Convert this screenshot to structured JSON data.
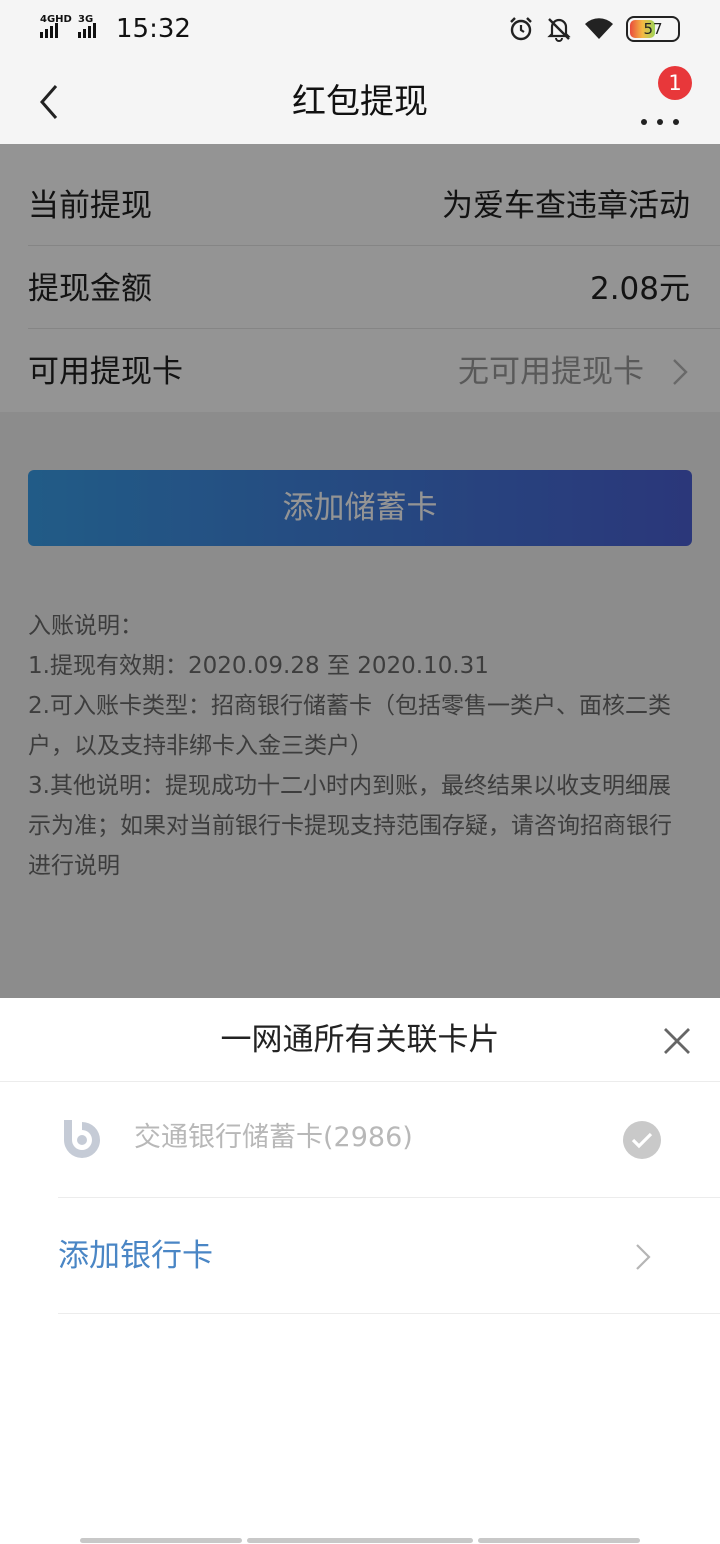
{
  "status_bar": {
    "network_1": "4GHD",
    "network_2": "3G",
    "time": "15:32",
    "battery": "57",
    "icons": [
      "alarm-icon",
      "bell-muted-icon",
      "wifi-icon",
      "battery-icon"
    ]
  },
  "nav": {
    "title": "红包提现",
    "badge_count": "1",
    "back_icon": "chevron-left-icon",
    "more_icon": "more-dots-icon"
  },
  "rows": [
    {
      "label": "当前提现",
      "value": "为爱车查违章活动"
    },
    {
      "label": "提现金额",
      "value": "2.08元"
    },
    {
      "label": "可用提现卡",
      "value": "无可用提现卡"
    }
  ],
  "add_savings_button": "添加储蓄卡",
  "notes": {
    "heading": "入账说明：",
    "line1": "1.提现有效期：2020.09.28 至 2020.10.31",
    "line2": "2.可入账卡类型：招商银行储蓄卡（包括零售一类户、面核二类户，以及支持非绑卡入金三类户）",
    "line3": "3.其他说明：提现成功十二小时内到账，最终结果以收支明细展示为准；如果对当前银行卡提现支持范围存疑，请咨询招商银行进行说明"
  },
  "sheet": {
    "title": "一网通所有关联卡片",
    "cards": [
      {
        "name": "交通银行储蓄卡(2986)",
        "icon": "bank-logo-icon",
        "selected": true
      }
    ],
    "add_bank_label": "添加银行卡"
  },
  "colors": {
    "accent_blue": "#4a86c5",
    "button_gradient_start": "#3a9ee8",
    "button_gradient_end": "#4a5fd3",
    "badge_red": "#e8373a"
  }
}
